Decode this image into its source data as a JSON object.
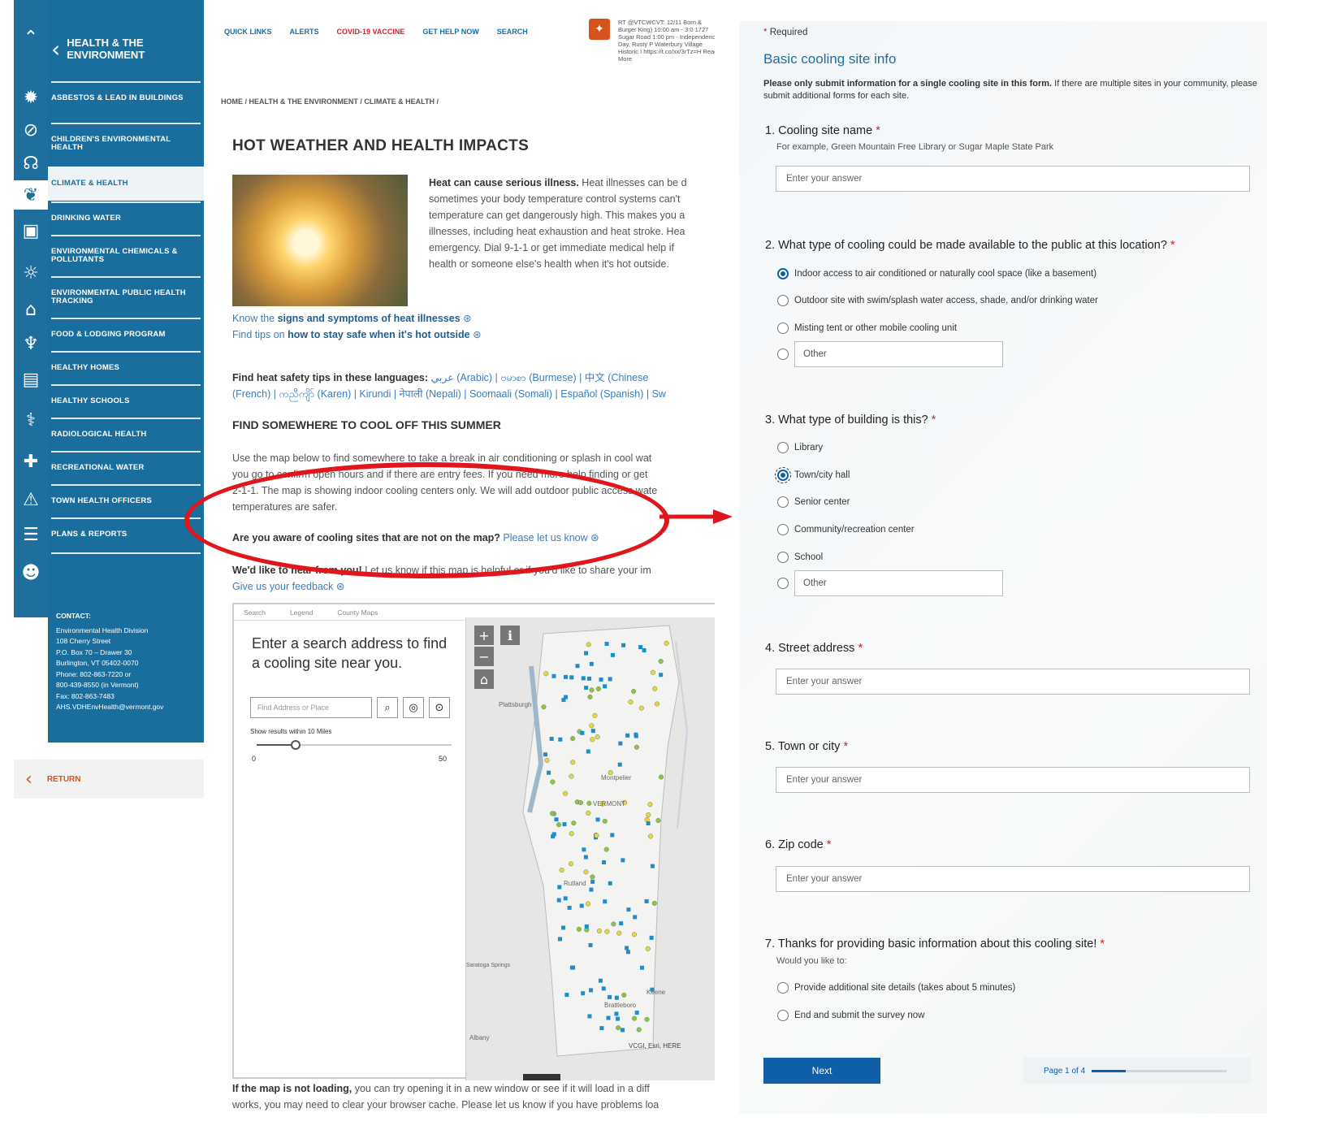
{
  "nav": {
    "header_title": "HEALTH & THE ENVIRONMENT",
    "items": [
      {
        "label": "ASBESTOS & LEAD IN BUILDINGS"
      },
      {
        "label": "CHILDREN'S ENVIRONMENTAL HEALTH"
      },
      {
        "label": "CLIMATE & HEALTH"
      },
      {
        "label": "DRINKING WATER"
      },
      {
        "label": "ENVIRONMENTAL CHEMICALS & POLLUTANTS"
      },
      {
        "label": "ENVIRONMENTAL PUBLIC HEALTH TRACKING"
      },
      {
        "label": "FOOD & LODGING PROGRAM"
      },
      {
        "label": "HEALTHY HOMES"
      },
      {
        "label": "HEALTHY SCHOOLS"
      },
      {
        "label": "RADIOLOGICAL HEALTH"
      },
      {
        "label": "RECREATIONAL WATER"
      },
      {
        "label": "TOWN HEALTH OFFICERS"
      },
      {
        "label": "PLANS & REPORTS"
      }
    ],
    "contact": {
      "label": "CONTACT:",
      "lines": [
        "Environmental Health Division",
        "108 Cherry Street",
        "P.O. Box 70 – Drawer 30",
        "Burlington, VT 05402-0070",
        "Phone: 802-863-7220 or",
        "800-439-8550 (in Vermont)",
        "Fax: 802-863-7483",
        "AHS.VDHEnvHealth@vermont.gov"
      ]
    },
    "return_label": "RETURN"
  },
  "rail_icons": [
    "logo-icon",
    "virus-icon",
    "compass-icon",
    "head-icon",
    "leaf-icon",
    "chart-icon",
    "sun-icon",
    "building-icon",
    "microscope-icon",
    "image-icon",
    "stethoscope-icon",
    "cross-icon",
    "warning-icon",
    "chat-icon",
    "people-icon"
  ],
  "page": {
    "top_links": [
      "QUICK LINKS",
      "ALERTS",
      "COVID-19 VACCINE",
      "GET HELP NOW",
      "SEARCH"
    ],
    "tweet_text": "RT @VTCWCVT: 12/11 Born & Burger King) 10:00 am - 3:0 1727 Sugar Road 1:00 pm - Independence Day, Rusty P Waterbury Village Historic I https://t.co/xx/3rTz=H Read More",
    "breadcrumb": "HOME / HEALTH & THE ENVIRONMENT / CLIMATE & HEALTH /",
    "title": "HOT WEATHER AND HEALTH IMPACTS",
    "intro_bold": "Heat can cause serious illness.",
    "intro_lines": [
      " Heat illnesses can be d",
      "sometimes your body temperature control systems can't",
      "temperature can get dangerously high. This makes you a",
      "illnesses, including heat exhaustion and heat stroke. Hea",
      "emergency. Dial 9-1-1 or get immediate medical help if",
      "health or someone else's health when it's hot outside."
    ],
    "link1_prefix": "Know the ",
    "link1_bold": "signs and symptoms of heat illnesses",
    "link2_prefix": "Find tips on ",
    "link2_bold": "how to stay safe when it's hot outside",
    "lang_bold": "Find heat safety tips in these languages:",
    "lang_line1": " عربي (Arabic) | ဗမာစာ (Burmese) | 中文 (Chinese",
    "lang_line2": "(French) | ကညီကျိာ် (Karen) | Kirundi | नेपाली (Nepali) | Soomaali (Somali) | Español (Spanish) | Sw",
    "cool_heading": "FIND SOMEWHERE TO COOL OFF THIS SUMMER",
    "map_intro": [
      "Use the map below to find somewhere to take a break in air conditioning or splash in cool wat",
      "you go to confirm open hours and if there are entry fees. If you need more help finding or get",
      "2-1-1. The map is showing indoor cooling centers only. We will add outdoor public access wate",
      "temperatures are safer."
    ],
    "aware_bold": "Are you aware of cooling sites that are not on the map?",
    "aware_link": " Please let us know",
    "feedback_bold": "We'd like to hear from you!",
    "feedback_text": " Let us know if this map is helpful or if you'd like to share your im",
    "feedback_link": "Give us your feedback",
    "map": {
      "tabs": [
        "Search",
        "Legend",
        "County Maps"
      ],
      "prompt": "Enter a search address to find a cooling site near you.",
      "search_placeholder": "Find Address or Place",
      "radius_label": "Show results within 10 Miles",
      "slider_min": "0",
      "slider_max": "50",
      "slider_value": 10,
      "place_labels": [
        "Plattsburgh",
        "Montpelier",
        "VERMONT",
        "Rutland",
        "Saratoga Springs",
        "Keene",
        "Brattleboro",
        "Albany"
      ],
      "attribution": "VCGI, Esri, HERE"
    },
    "bottom_bold": "If the map is not loading,",
    "bottom_line1": " you can try opening it in a new window or see if it will load in a diff",
    "bottom_line2": "works, you may need to clear your browser cache. Please let us know if you have problems loa"
  },
  "form": {
    "required_label": "Required",
    "section_title": "Basic cooling site info",
    "intro_bold": "Please only submit information for a single cooling site in this form.",
    "intro_text": " If there are multiple sites in your community, please submit additional forms for each site.",
    "q1": {
      "title": "1. Cooling site name",
      "sub": "For example, Green Mountain Free Library or Sugar Maple State Park",
      "placeholder": "Enter your answer"
    },
    "q2": {
      "title": "2. What type of cooling could be made available to the public at this location?",
      "options": [
        "Indoor access to air conditioned or naturally cool space (like a basement)",
        "Outdoor site with swim/splash water access, shade, and/or drinking water",
        "Misting tent or other mobile cooling unit"
      ],
      "other": "Other"
    },
    "q3": {
      "title": "3. What type of building is this?",
      "options": [
        "Library",
        "Town/city hall",
        "Senior center",
        "Community/recreation center",
        "School"
      ],
      "other": "Other"
    },
    "q4": {
      "title": "4. Street address",
      "placeholder": "Enter your answer"
    },
    "q5": {
      "title": "5. Town or city",
      "placeholder": "Enter your answer"
    },
    "q6": {
      "title": "6. Zip code",
      "placeholder": "Enter your answer"
    },
    "q7": {
      "title": "7. Thanks for providing basic information about this cooling site!",
      "sub": "Would you like to:",
      "options": [
        "Provide additional site details (takes about 5 minutes)",
        "End and submit the survey now"
      ]
    },
    "next_label": "Next",
    "page_label": "Page 1 of 4",
    "progress": 0.25
  },
  "colors": {
    "nav_blue": "#1a6e9e",
    "annotation_red": "#e0161c",
    "form_blue": "#0f5ea8",
    "accent_orange": "#d8521b"
  }
}
